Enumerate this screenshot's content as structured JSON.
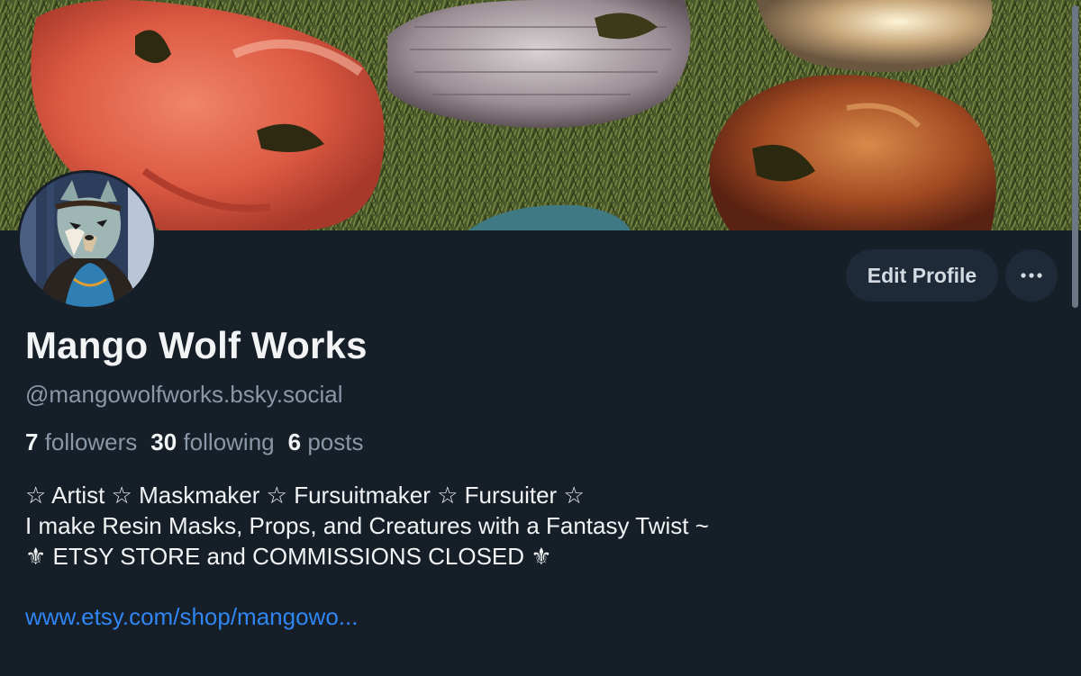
{
  "profile": {
    "display_name": "Mango Wolf Works",
    "handle": "@mangowolfworks.bsky.social",
    "stats": {
      "followers_count": "7",
      "followers_label": "followers",
      "following_count": "30",
      "following_label": "following",
      "posts_count": "6",
      "posts_label": "posts"
    },
    "bio_lines": [
      "☆ Artist ☆ Maskmaker ☆ Fursuitmaker ☆ Fursuiter ☆",
      "I make Resin Masks, Props, and Creatures with a Fantasy Twist ~",
      "⚜ ETSY STORE and COMMISSIONS CLOSED ⚜"
    ],
    "link": "www.etsy.com/shop/mangowo..."
  },
  "actions": {
    "edit_profile_label": "Edit Profile",
    "more_label": "···"
  },
  "icons": {
    "more": "ellipsis-icon"
  },
  "colors": {
    "background": "#161e27",
    "button_bg": "#1e2a37",
    "link": "#2f86f2",
    "muted_text": "#8a97a6",
    "primary_text": "#f1f3f5"
  }
}
